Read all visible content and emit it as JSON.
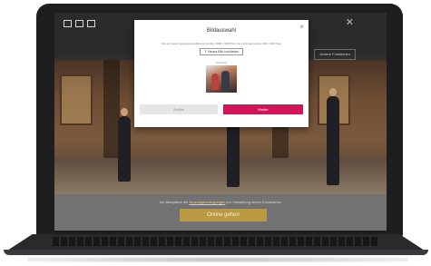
{
  "app_bar": {
    "close_glyph": "✕",
    "action_button_label": "Andere Funktionen"
  },
  "dialog": {
    "title": "Bildauswahl",
    "close_glyph": "×",
    "hint": "Die am besten geeignete Auflösung beträgt: 1800 x 900 Pixel, die minimale Größe: 600 x 300 Pixel",
    "upload_label": "Neues Bild hochladen",
    "upload_icon": "upload-icon",
    "preview_label": "Vorschau",
    "back_label": "Zurück",
    "next_label": "Weiter"
  },
  "footer": {
    "text_before": "Ich akzeptiere die",
    "link_text": "Nutzungsbedingungen",
    "text_after": "zur Verwaltung dieser Kunstwerke",
    "cta_label": "Online gehen"
  },
  "colors": {
    "accent": "#d4145a",
    "cta": "#b99a43"
  }
}
